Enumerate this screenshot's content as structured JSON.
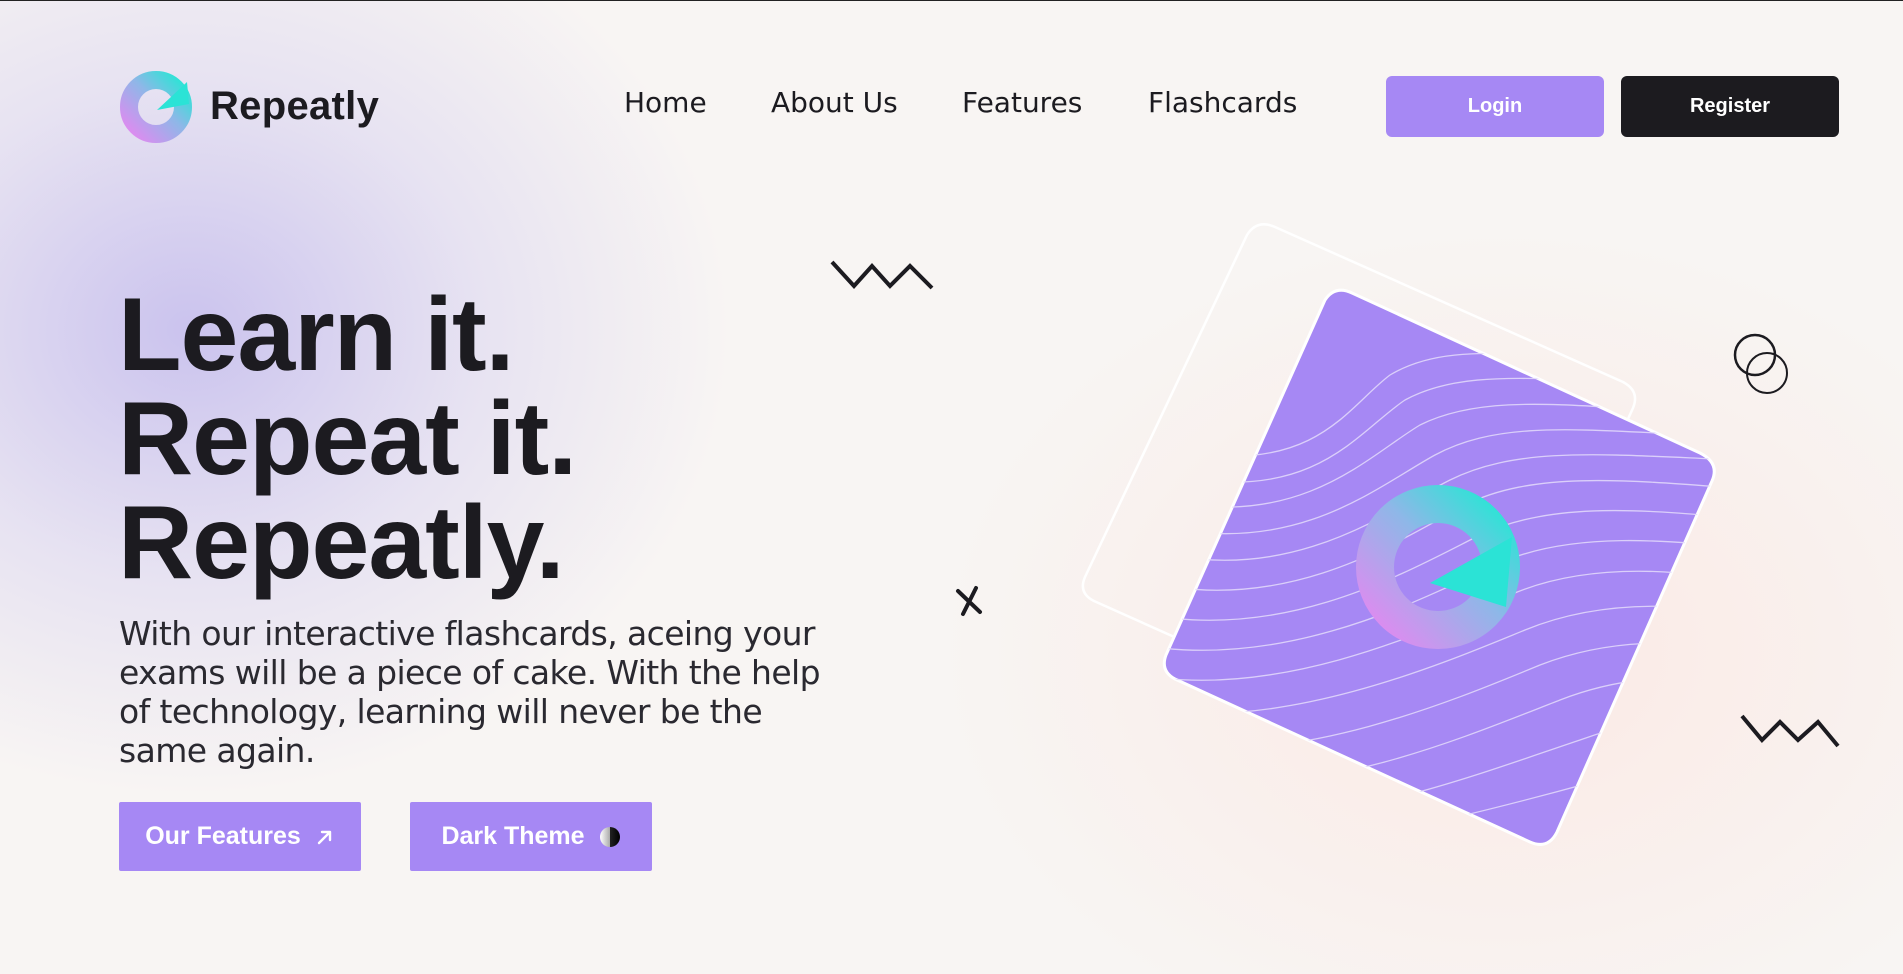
{
  "brand": {
    "name": "Repeatly"
  },
  "nav": {
    "links": [
      "Home",
      "About Us",
      "Features",
      "Flashcards"
    ],
    "login_label": "Login",
    "register_label": "Register"
  },
  "hero": {
    "headline": [
      "Learn it.",
      "Repeat it.",
      "Repeatly."
    ],
    "description": "With our interactive flashcards, aceing your exams will be a piece of cake. With the help of technology, learning will never be the same again.",
    "cta_features_label": "Our Features",
    "cta_theme_label": "Dark Theme"
  },
  "icons": {
    "features_arrow": "arrow-up-right-icon",
    "theme_toggle": "half-circle-contrast-icon",
    "logo": "repeatly-logo-icon"
  },
  "colors": {
    "accent": "#a688f4",
    "dark": "#1c1b1f",
    "logo_teal": "#2de3d6",
    "logo_pink": "#d58ef2"
  }
}
